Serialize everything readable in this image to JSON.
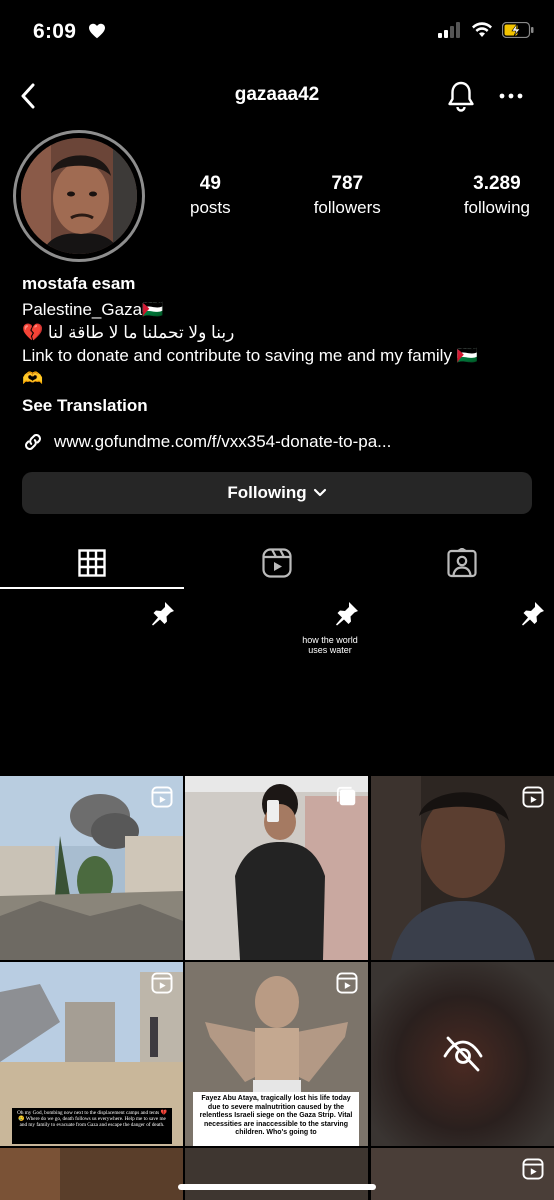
{
  "status_bar": {
    "time": "6:09"
  },
  "header": {
    "username": "gazaaa42"
  },
  "stats": [
    {
      "value": "49",
      "label": "posts"
    },
    {
      "value": "787",
      "label": "followers"
    },
    {
      "value": "3.289",
      "label": "following"
    }
  ],
  "bio": {
    "name": "mostafa esam",
    "line1": "Palestine_Gaza🇵🇸",
    "line2": "💔 ربنا ولا تحملنا ما لا طاقة لنا",
    "line3": "Link to donate and contribute to saving me and my family 🇵🇸",
    "line4": "🫶",
    "see_translation": "See Translation"
  },
  "link": {
    "text": "www.gofundme.com/f/vxx354-donate-to-pa..."
  },
  "follow_button": {
    "label": "Following"
  },
  "pinned": {
    "caption": "how the world uses water"
  },
  "posts": {
    "p1_caption": "Oh my God, bombing now next to the displacement camps and tents 💔😢 Where do we go, death follows us everywhere. Help me to save me and my family to evacuate from Gaza and escape the danger of death.",
    "p2_caption": "Fayez Abu Ataya, tragically lost his life today due to severe malnutrition caused by the relentless Israeli siege on the Gaza Strip. Vital necessities are inaccessible to the starving children. Who's going to"
  },
  "colors": {
    "background": "#000000",
    "button": "#262626",
    "ring": "#8e8e8e"
  }
}
